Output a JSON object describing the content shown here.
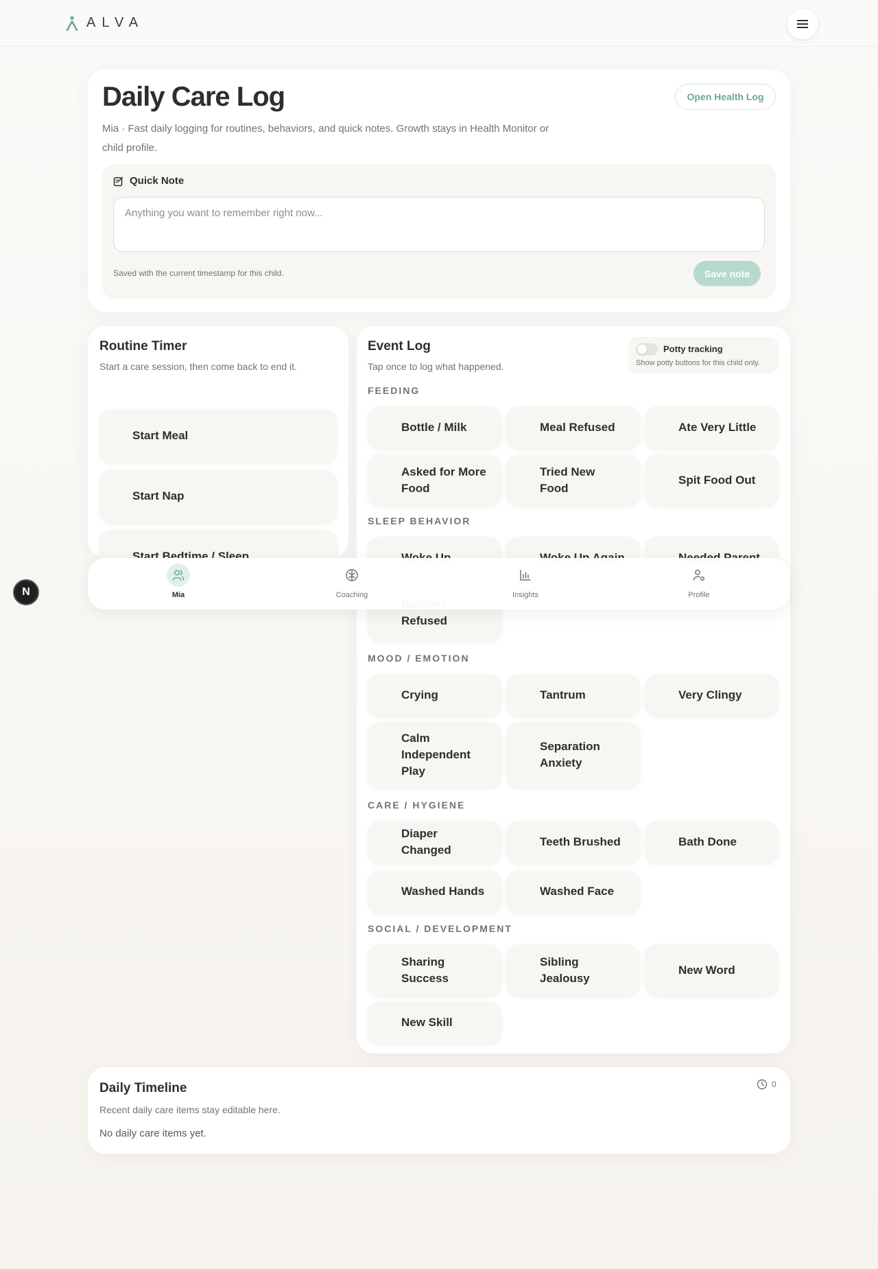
{
  "header": {
    "brand": "ALVA"
  },
  "care_log": {
    "title": "Daily Care Log",
    "subtitle": "Mia · Fast daily logging for routines, behaviors, and quick notes. Growth stays in Health Monitor or child profile.",
    "open_health_label": "Open Health Log",
    "quick_note": {
      "label": "Quick Note",
      "placeholder": "Anything you want to remember right now...",
      "footer": "Saved with the current timestamp for this child.",
      "save_label": "Save note"
    }
  },
  "routine_timer": {
    "title": "Routine Timer",
    "subtitle": "Start a care session, then come back to end it.",
    "buttons": [
      "Start Meal",
      "Start Nap",
      "Start Bedtime / Sleep"
    ]
  },
  "event_log": {
    "title": "Event Log",
    "subtitle": "Tap once to log what happened.",
    "potty": {
      "label": "Potty tracking",
      "sub": "Show potty buttons for this child only."
    },
    "categories": [
      {
        "name": "FEEDING",
        "items": [
          "Bottle / Milk",
          "Meal Refused",
          "Ate Very Little",
          "Asked for More Food",
          "Tried New Food",
          "Spit Food Out"
        ]
      },
      {
        "name": "SLEEP BEHAVIOR",
        "items": [
          "Woke Up",
          "Woke Up Again",
          "Needed Parent",
          "Bedtime Refused"
        ]
      },
      {
        "name": "MOOD / EMOTION",
        "items": [
          "Crying",
          "Tantrum",
          "Very Clingy",
          "Calm Independent Play",
          "Separation Anxiety"
        ]
      },
      {
        "name": "CARE / HYGIENE",
        "items": [
          "Diaper Changed",
          "Teeth Brushed",
          "Bath Done",
          "Washed Hands",
          "Washed Face"
        ]
      },
      {
        "name": "SOCIAL / DEVELOPMENT",
        "items": [
          "Sharing Success",
          "Sibling Jealousy",
          "New Word",
          "New Skill"
        ]
      }
    ]
  },
  "nav": {
    "items": [
      {
        "label": "Mia",
        "icon": "users-icon",
        "active": true
      },
      {
        "label": "Coaching",
        "icon": "brain-icon",
        "active": false
      },
      {
        "label": "Insights",
        "icon": "bar-chart-icon",
        "active": false
      },
      {
        "label": "Profile",
        "icon": "user-settings-icon",
        "active": false
      }
    ]
  },
  "dev_badge": "N",
  "timeline": {
    "title": "Daily Timeline",
    "subtitle": "Recent daily care items stay editable here.",
    "count": "0",
    "empty": "No daily care items yet."
  },
  "colors": {
    "accent": "#6aa79a",
    "accent_soft": "#b7d9d0",
    "card": "#ffffff",
    "tile": "#f8f6f2"
  }
}
